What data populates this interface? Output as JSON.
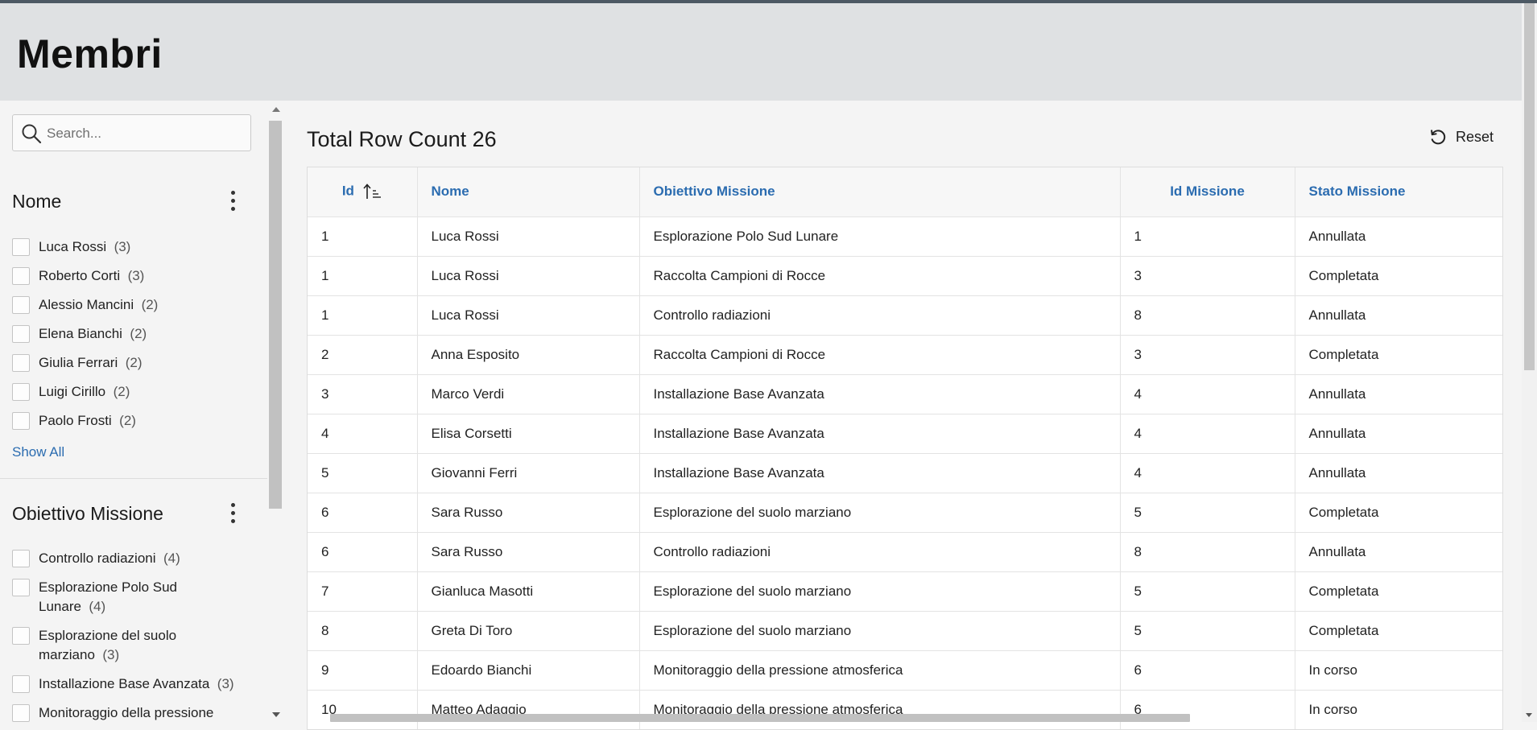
{
  "page": {
    "title": "Membri"
  },
  "search": {
    "placeholder": "Search..."
  },
  "facets": {
    "nome": {
      "title": "Nome",
      "items": [
        {
          "label": "Luca Rossi",
          "count": "(3)"
        },
        {
          "label": "Roberto Corti",
          "count": "(3)"
        },
        {
          "label": "Alessio Mancini",
          "count": "(2)"
        },
        {
          "label": "Elena Bianchi",
          "count": "(2)"
        },
        {
          "label": "Giulia Ferrari",
          "count": "(2)"
        },
        {
          "label": "Luigi Cirillo",
          "count": "(2)"
        },
        {
          "label": "Paolo Frosti",
          "count": "(2)"
        }
      ],
      "show_all": "Show All"
    },
    "obiettivo": {
      "title": "Obiettivo Missione",
      "items": [
        {
          "label": "Controllo radiazioni",
          "count": "(4)"
        },
        {
          "label": "Esplorazione Polo Sud Lunare",
          "count": "(4)"
        },
        {
          "label": "Esplorazione del suolo marziano",
          "count": "(3)"
        },
        {
          "label": "Installazione Base Avanzata",
          "count": "(3)"
        },
        {
          "label": "Monitoraggio della pressione",
          "count": ""
        }
      ]
    }
  },
  "report": {
    "row_count_label": "Total Row Count 26",
    "reset_label": "Reset",
    "columns": [
      "Id",
      "Nome",
      "Obiettivo Missione",
      "Id Missione",
      "Stato Missione"
    ],
    "sort": "ascending",
    "rows": [
      [
        "1",
        "Luca Rossi",
        "Esplorazione Polo Sud Lunare",
        "1",
        "Annullata"
      ],
      [
        "1",
        "Luca Rossi",
        "Raccolta Campioni di Rocce",
        "3",
        "Completata"
      ],
      [
        "1",
        "Luca Rossi",
        "Controllo radiazioni",
        "8",
        "Annullata"
      ],
      [
        "2",
        "Anna Esposito",
        "Raccolta Campioni di Rocce",
        "3",
        "Completata"
      ],
      [
        "3",
        "Marco Verdi",
        "Installazione Base Avanzata",
        "4",
        "Annullata"
      ],
      [
        "4",
        "Elisa Corsetti",
        "Installazione Base Avanzata",
        "4",
        "Annullata"
      ],
      [
        "5",
        "Giovanni Ferri",
        "Installazione Base Avanzata",
        "4",
        "Annullata"
      ],
      [
        "6",
        "Sara Russo",
        "Esplorazione del suolo marziano",
        "5",
        "Completata"
      ],
      [
        "6",
        "Sara Russo",
        "Controllo radiazioni",
        "8",
        "Annullata"
      ],
      [
        "7",
        "Gianluca Masotti",
        "Esplorazione del suolo marziano",
        "5",
        "Completata"
      ],
      [
        "8",
        "Greta Di Toro",
        "Esplorazione del suolo marziano",
        "5",
        "Completata"
      ],
      [
        "9",
        "Edoardo Bianchi",
        "Monitoraggio della pressione atmosferica",
        "6",
        "In corso"
      ],
      [
        "10",
        "Matteo Adaggio",
        "Monitoraggio della pressione atmosferica",
        "6",
        "In corso"
      ]
    ]
  },
  "colors": {
    "accent": "#2b6cb0",
    "header_bg": "#dfe1e3",
    "topline": "#4d5964"
  }
}
